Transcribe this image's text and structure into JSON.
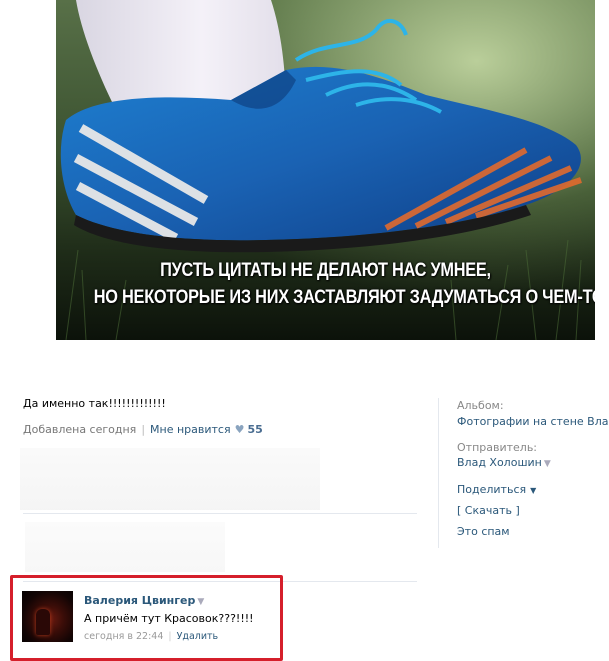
{
  "photo": {
    "caption_line1": "ПУСТЬ ЦИТАТЫ НЕ ДЕЛАЮТ НАС УМНЕЕ,",
    "caption_line2": "НО НЕКОТОРЫЕ ИЗ НИХ ЗАСТАВЛЯЮТ ЗАДУМАТЬСЯ О ЧЕМ-ТО..."
  },
  "post": {
    "description": "Да именно так!!!!!!!!!!!!!",
    "added": "Добавлена сегодня",
    "like_label": "Мне нравится",
    "like_count": "55"
  },
  "sidebar": {
    "album_label": "Альбом:",
    "album_link": "Фотографии на стене Влада",
    "sender_label": "Отправитель:",
    "sender_name": "Влад Холошин",
    "share_label": "Поделиться",
    "download_label": "[ Скачать ]",
    "spam_label": "Это спам"
  },
  "comment": {
    "author": "Валерия Цвингер",
    "text": "А причём тут Красовок???!!!!",
    "time": "сегодня в 22:44",
    "delete_label": "Удалить"
  },
  "colors": {
    "link": "#2b587a",
    "highlight_border": "#d51f2b",
    "heart": "#8aa4bf"
  }
}
